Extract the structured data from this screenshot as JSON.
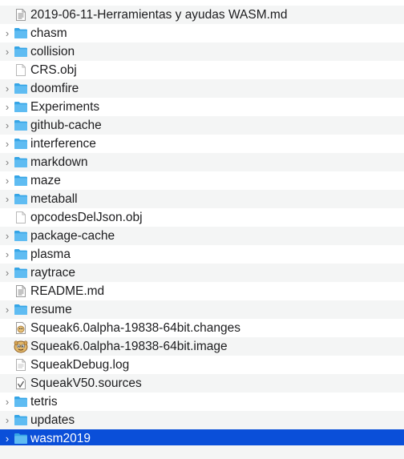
{
  "finder": {
    "rows": [
      {
        "name": "2019-06-11-Herramientas y ayudas WASM.md",
        "icon": "markdown-doc-icon",
        "folder": false
      },
      {
        "name": "chasm",
        "icon": "folder-icon",
        "folder": true
      },
      {
        "name": "collision",
        "icon": "folder-icon",
        "folder": true
      },
      {
        "name": "CRS.obj",
        "icon": "blank-file-icon",
        "folder": false
      },
      {
        "name": "doomfire",
        "icon": "folder-icon",
        "folder": true
      },
      {
        "name": "Experiments",
        "icon": "folder-icon",
        "folder": true
      },
      {
        "name": "github-cache",
        "icon": "folder-icon",
        "folder": true
      },
      {
        "name": "interference",
        "icon": "folder-icon",
        "folder": true
      },
      {
        "name": "markdown",
        "icon": "folder-icon",
        "folder": true
      },
      {
        "name": "maze",
        "icon": "folder-icon",
        "folder": true
      },
      {
        "name": "metaball",
        "icon": "folder-icon",
        "folder": true
      },
      {
        "name": "opcodesDelJson.obj",
        "icon": "blank-file-icon",
        "folder": false
      },
      {
        "name": "package-cache",
        "icon": "folder-icon",
        "folder": true
      },
      {
        "name": "plasma",
        "icon": "folder-icon",
        "folder": true
      },
      {
        "name": "raytrace",
        "icon": "folder-icon",
        "folder": true
      },
      {
        "name": "README.md",
        "icon": "markdown-doc-icon",
        "folder": false
      },
      {
        "name": "resume",
        "icon": "folder-icon",
        "folder": true
      },
      {
        "name": "Squeak6.0alpha-19838-64bit.changes",
        "icon": "squeak-changes-icon",
        "folder": false
      },
      {
        "name": "Squeak6.0alpha-19838-64bit.image",
        "icon": "squeak-image-icon",
        "folder": false
      },
      {
        "name": "SqueakDebug.log",
        "icon": "log-file-icon",
        "folder": false
      },
      {
        "name": "SqueakV50.sources",
        "icon": "squeak-sources-icon",
        "folder": false
      },
      {
        "name": "tetris",
        "icon": "folder-icon",
        "folder": true
      },
      {
        "name": "updates",
        "icon": "folder-icon",
        "folder": true
      },
      {
        "name": "wasm2019",
        "icon": "folder-icon",
        "folder": true,
        "selected": true
      }
    ],
    "colors": {
      "selection": "#0a4fd9",
      "folder": "#35a5e6",
      "stripe": "#f4f5f5"
    }
  }
}
